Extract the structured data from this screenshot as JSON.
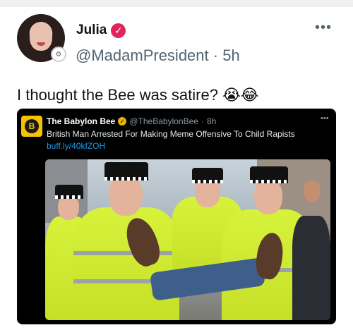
{
  "tweet": {
    "display_name": "Julia",
    "handle": "@MadamPresident",
    "separator": "·",
    "time": "5h",
    "text": "I thought the Bee was satire? 😭😂",
    "more_icon": "more-icon",
    "verified_icon": "verified-icon"
  },
  "embed": {
    "name": "The Babylon Bee",
    "handle": "@TheBabylonBee",
    "separator": "·",
    "time": "8h",
    "headline": "British Man Arrested For Making Meme Offensive To Child Rapists",
    "link": "buff.ly/40kfZOH",
    "more_icon": "more-icon"
  },
  "colors": {
    "verified_badge": "#e0245e",
    "link": "#1d9bf0",
    "hi_vis": "#d7f23a"
  }
}
